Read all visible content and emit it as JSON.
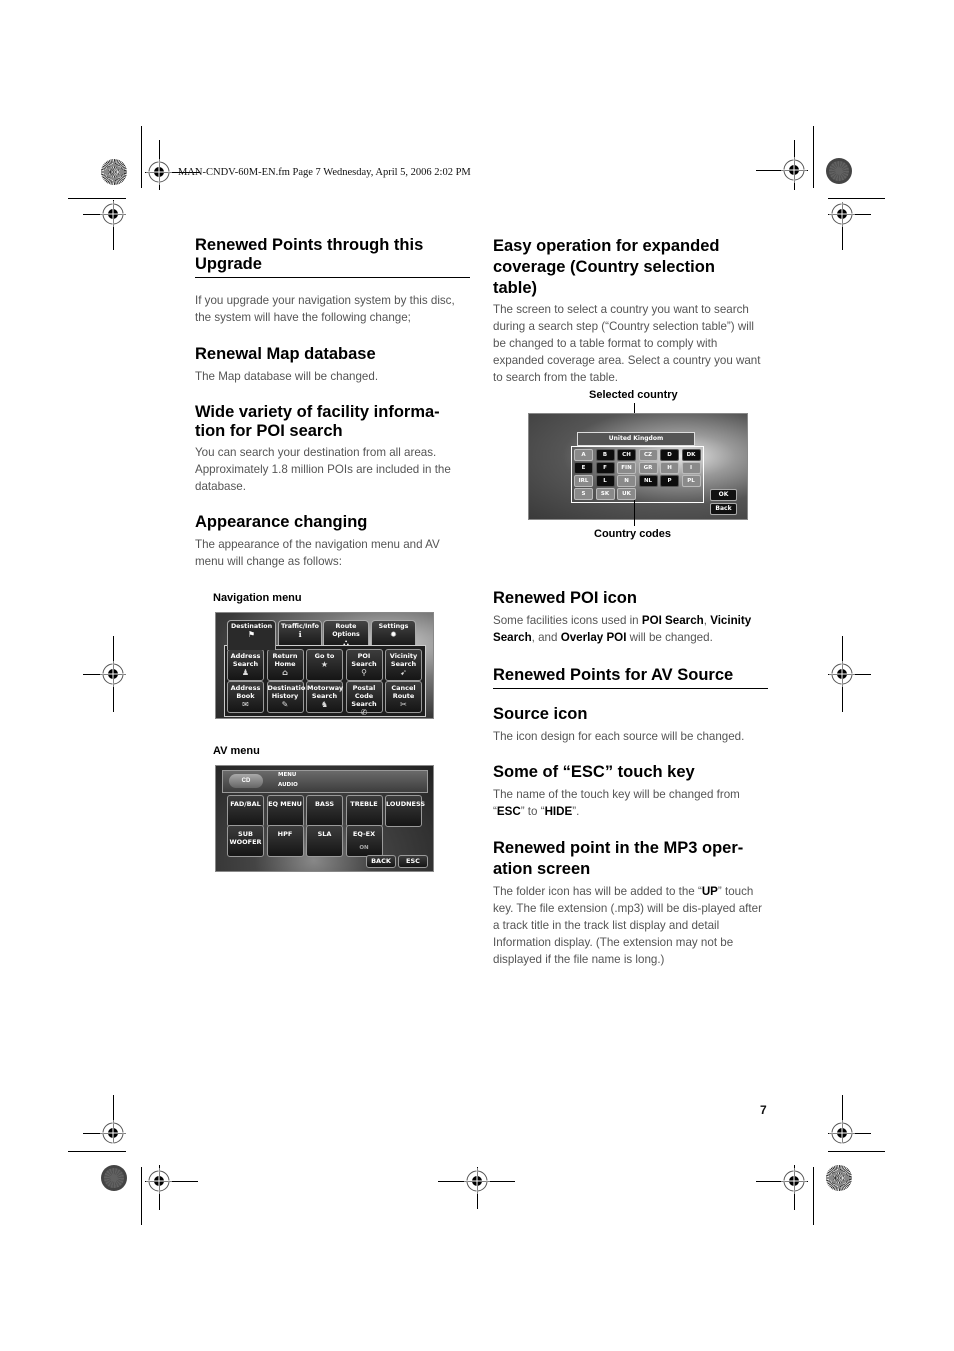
{
  "print_header": "MAN-CNDV-60M-EN.fm  Page 7  Wednesday, April 5, 2006  2:02 PM",
  "page_number": "7",
  "left_column": {
    "section_title": "Renewed Points through this Upgrade",
    "intro": "If you upgrade your navigation system by this disc, the system will have the following change;",
    "map_db": {
      "title": "Renewal Map database",
      "text": "The Map database will be changed."
    },
    "poi_variety": {
      "title": "Wide variety of facility informa-tion for POI search",
      "text": "You can search your destination from all areas. Approximately 1.8 million POIs are included in the database."
    },
    "appearance": {
      "title": "Appearance changing",
      "text": "The appearance of the navigation menu and AV menu will change as follows:"
    },
    "nav_menu": {
      "caption": "Navigation menu",
      "tabs": [
        {
          "label": "Destination",
          "icon": "flag-icon",
          "active": true
        },
        {
          "label": "Traffic/Info",
          "icon": "info-icon",
          "active": false
        },
        {
          "label": "Route Options",
          "icon": "route-icon",
          "active": false
        },
        {
          "label": "Settings",
          "icon": "gear-icon",
          "active": false
        }
      ],
      "buttons": [
        {
          "label": "Address Search",
          "icon": "person-icon"
        },
        {
          "label": "Return Home",
          "icon": "home-icon"
        },
        {
          "label": "Go to",
          "icon": "star-icon"
        },
        {
          "label": "POI Search",
          "icon": "poi-icon"
        },
        {
          "label": "Vicinity Search",
          "icon": "vicinity-icon"
        },
        {
          "label": "Address Book",
          "icon": "book-icon"
        },
        {
          "label": "Destination History",
          "icon": "history-icon"
        },
        {
          "label": "Motorway Search",
          "icon": "motorway-icon"
        },
        {
          "label": "Postal Code Search",
          "icon": "postal-icon"
        },
        {
          "label": "Cancel Route",
          "icon": "cancel-route-icon"
        }
      ]
    },
    "av_menu": {
      "caption": "AV menu",
      "source_badge": "CD",
      "header_line1": "MENU",
      "header_line2": "AUDIO",
      "buttons": [
        {
          "label": "FAD/BAL"
        },
        {
          "label": "EQ MENU"
        },
        {
          "label": "BASS"
        },
        {
          "label": "TREBLE"
        },
        {
          "label": "LOUDNESS"
        },
        {
          "label": "SUB WOOFER"
        },
        {
          "label": "HPF"
        },
        {
          "label": "SLA"
        },
        {
          "label": "EQ-EX",
          "sub": "ON"
        }
      ],
      "back_label": "BACK",
      "esc_label": "ESC"
    }
  },
  "right_column": {
    "country_table": {
      "title": "Easy operation for expanded coverage (Country selection table)",
      "text": "The screen to select a country you want to search during a search step (“Country selection table”) will be changed to a table format to comply with expanded coverage area. Select a country you want to search from the table.",
      "label_top": "Selected country",
      "label_bottom": "Country codes",
      "selected_country": "United Kingdom",
      "codes": [
        {
          "code": "A",
          "tone": "light"
        },
        {
          "code": "B",
          "tone": "dark"
        },
        {
          "code": "CH",
          "tone": "dark"
        },
        {
          "code": "CZ",
          "tone": "light"
        },
        {
          "code": "D",
          "tone": "dark"
        },
        {
          "code": "DK",
          "tone": "dark"
        },
        {
          "code": "E",
          "tone": "dark"
        },
        {
          "code": "F",
          "tone": "dark"
        },
        {
          "code": "FIN",
          "tone": "light"
        },
        {
          "code": "GR",
          "tone": "light"
        },
        {
          "code": "H",
          "tone": "light"
        },
        {
          "code": "I",
          "tone": "light"
        },
        {
          "code": "IRL",
          "tone": "light"
        },
        {
          "code": "L",
          "tone": "dark"
        },
        {
          "code": "N",
          "tone": "light"
        },
        {
          "code": "NL",
          "tone": "dark"
        },
        {
          "code": "P",
          "tone": "dark"
        },
        {
          "code": "PL",
          "tone": "light"
        },
        {
          "code": "S",
          "tone": "light"
        },
        {
          "code": "SK",
          "tone": "light"
        },
        {
          "code": "UK",
          "tone": "light"
        }
      ],
      "ok_label": "OK",
      "back_label": "Back"
    },
    "poi_icon": {
      "title": "Renewed POI icon",
      "text_pre": "Some facilities icons used in ",
      "bold1": "POI Search",
      "mid1": ", ",
      "bold2": "Vicinity Search",
      "mid2": ", and ",
      "bold3": "Overlay POI",
      "text_post": " will be changed."
    },
    "av_section_title": "Renewed Points for AV Source",
    "source_icon": {
      "title": "Source icon",
      "text": "The icon design for each source will be changed."
    },
    "esc_key": {
      "title": "Some of “ESC” touch key",
      "text_pre": "The name of the touch key will be changed from “",
      "bold1": "ESC",
      "mid": "” to “",
      "bold2": "HIDE",
      "text_post": "”."
    },
    "mp3": {
      "title": "Renewed point in the MP3 oper-ation screen",
      "text_pre": "The folder icon has will be added to the “",
      "bold": "UP",
      "text_post": "” touch key. The file extension (.mp3) will be dis-played after a track title in the track list display and detail Information display. (The extension may not be displayed if the file name is long.)"
    }
  }
}
